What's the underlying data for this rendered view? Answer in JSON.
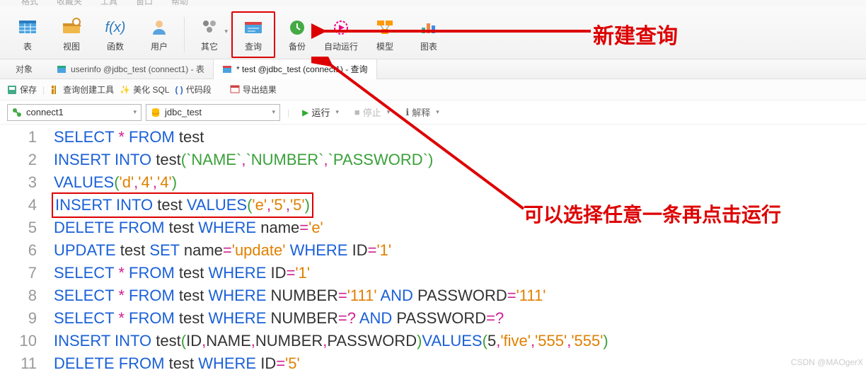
{
  "menubar": [
    "格式",
    "收藏夹",
    "工具",
    "窗口",
    "帮助"
  ],
  "ribbon": [
    {
      "id": "table",
      "label": "表",
      "icon": "table"
    },
    {
      "id": "view",
      "label": "视图",
      "icon": "view"
    },
    {
      "id": "func",
      "label": "函数",
      "icon": "fx"
    },
    {
      "id": "user",
      "label": "用户",
      "icon": "user"
    },
    {
      "sep": true
    },
    {
      "id": "other",
      "label": "其它",
      "icon": "other",
      "dd": true
    },
    {
      "id": "query",
      "label": "查询",
      "icon": "query",
      "active": true
    },
    {
      "id": "backup",
      "label": "备份",
      "icon": "backup"
    },
    {
      "id": "auto",
      "label": "自动运行",
      "icon": "auto"
    },
    {
      "id": "model",
      "label": "模型",
      "icon": "model"
    },
    {
      "id": "chart",
      "label": "图表",
      "icon": "chart"
    }
  ],
  "tabs": {
    "objects": "对象",
    "items": [
      {
        "icon": "tbl",
        "label": "userinfo @jdbc_test (connect1) - 表",
        "active": false
      },
      {
        "icon": "qry",
        "label": "* test @jdbc_test (connect1) - 查询",
        "active": true
      }
    ]
  },
  "qtoolbar": {
    "save": "保存",
    "qbuilder": "查询创建工具",
    "beautify": "美化 SQL",
    "snippet": "代码段",
    "export": "导出结果"
  },
  "combos": {
    "connection": "connect1",
    "database": "jdbc_test",
    "run": "运行",
    "stop": "停止",
    "explain": "解释"
  },
  "code": [
    {
      "n": 1,
      "tokens": [
        [
          "kw",
          "SELECT"
        ],
        [
          "sp",
          " "
        ],
        [
          "sy",
          "*"
        ],
        [
          "sp",
          " "
        ],
        [
          "kw",
          "FROM"
        ],
        [
          "sp",
          " "
        ],
        [
          "id",
          "test"
        ]
      ]
    },
    {
      "n": 2,
      "tokens": [
        [
          "kw",
          "INSERT"
        ],
        [
          "sp",
          " "
        ],
        [
          "kw",
          "INTO"
        ],
        [
          "sp",
          " "
        ],
        [
          "id",
          "test"
        ],
        [
          "bk",
          "("
        ],
        [
          "bk",
          "`NAME`"
        ],
        [
          "sy",
          ","
        ],
        [
          "bk",
          "`NUMBER`"
        ],
        [
          "sy",
          ","
        ],
        [
          "bk",
          "`PASSWORD`"
        ],
        [
          "bk",
          ")"
        ]
      ]
    },
    {
      "n": 3,
      "tokens": [
        [
          "kw",
          "VALUES"
        ],
        [
          "bk",
          "("
        ],
        [
          "str",
          "'d'"
        ],
        [
          "sy",
          ","
        ],
        [
          "str",
          "'4'"
        ],
        [
          "sy",
          ","
        ],
        [
          "str",
          "'4'"
        ],
        [
          "bk",
          ")"
        ]
      ]
    },
    {
      "n": 4,
      "hl": true,
      "tokens": [
        [
          "kw",
          "INSERT"
        ],
        [
          "sp",
          " "
        ],
        [
          "kw",
          "INTO"
        ],
        [
          "sp",
          " "
        ],
        [
          "id",
          "test"
        ],
        [
          "sp",
          " "
        ],
        [
          "kw",
          "VALUES"
        ],
        [
          "bk",
          "("
        ],
        [
          "str",
          "'e'"
        ],
        [
          "sy",
          ","
        ],
        [
          "str",
          "'5'"
        ],
        [
          "sy",
          ","
        ],
        [
          "str",
          "'5'"
        ],
        [
          "bk",
          ")"
        ]
      ]
    },
    {
      "n": 5,
      "tokens": [
        [
          "kw",
          "DELETE"
        ],
        [
          "sp",
          " "
        ],
        [
          "kw",
          "FROM"
        ],
        [
          "sp",
          " "
        ],
        [
          "id",
          "test"
        ],
        [
          "sp",
          " "
        ],
        [
          "kw",
          "WHERE"
        ],
        [
          "sp",
          " "
        ],
        [
          "id",
          "name"
        ],
        [
          "sy",
          "="
        ],
        [
          "str",
          "'e'"
        ]
      ]
    },
    {
      "n": 6,
      "tokens": [
        [
          "kw",
          "UPDATE"
        ],
        [
          "sp",
          " "
        ],
        [
          "id",
          "test"
        ],
        [
          "sp",
          " "
        ],
        [
          "kw",
          "SET"
        ],
        [
          "sp",
          " "
        ],
        [
          "id",
          "name"
        ],
        [
          "sy",
          "="
        ],
        [
          "str",
          "'update'"
        ],
        [
          "sp",
          " "
        ],
        [
          "kw",
          "WHERE"
        ],
        [
          "sp",
          " "
        ],
        [
          "id",
          "ID"
        ],
        [
          "sy",
          "="
        ],
        [
          "str",
          "'1'"
        ]
      ]
    },
    {
      "n": 7,
      "tokens": [
        [
          "kw",
          "SELECT"
        ],
        [
          "sp",
          " "
        ],
        [
          "sy",
          "*"
        ],
        [
          "sp",
          " "
        ],
        [
          "kw",
          "FROM"
        ],
        [
          "sp",
          " "
        ],
        [
          "id",
          "test"
        ],
        [
          "sp",
          " "
        ],
        [
          "kw",
          "WHERE"
        ],
        [
          "sp",
          " "
        ],
        [
          "id",
          "ID"
        ],
        [
          "sy",
          "="
        ],
        [
          "str",
          "'1'"
        ]
      ]
    },
    {
      "n": 8,
      "tokens": [
        [
          "kw",
          "SELECT"
        ],
        [
          "sp",
          " "
        ],
        [
          "sy",
          "*"
        ],
        [
          "sp",
          " "
        ],
        [
          "kw",
          "FROM"
        ],
        [
          "sp",
          " "
        ],
        [
          "id",
          "test"
        ],
        [
          "sp",
          " "
        ],
        [
          "kw",
          "WHERE"
        ],
        [
          "sp",
          " "
        ],
        [
          "id",
          "NUMBER"
        ],
        [
          "sy",
          "="
        ],
        [
          "str",
          "'111'"
        ],
        [
          "sp",
          " "
        ],
        [
          "kw",
          "AND"
        ],
        [
          "sp",
          " "
        ],
        [
          "id",
          "PASSWORD"
        ],
        [
          "sy",
          "="
        ],
        [
          "str",
          "'111'"
        ]
      ]
    },
    {
      "n": 9,
      "tokens": [
        [
          "kw",
          "SELECT"
        ],
        [
          "sp",
          " "
        ],
        [
          "sy",
          "*"
        ],
        [
          "sp",
          " "
        ],
        [
          "kw",
          "FROM"
        ],
        [
          "sp",
          " "
        ],
        [
          "id",
          "test"
        ],
        [
          "sp",
          " "
        ],
        [
          "kw",
          "WHERE"
        ],
        [
          "sp",
          " "
        ],
        [
          "id",
          "NUMBER"
        ],
        [
          "sy",
          "=?"
        ],
        [
          "sp",
          " "
        ],
        [
          "kw",
          "AND"
        ],
        [
          "sp",
          " "
        ],
        [
          "id",
          "PASSWORD"
        ],
        [
          "sy",
          "=?"
        ]
      ]
    },
    {
      "n": 10,
      "tokens": [
        [
          "kw",
          "INSERT"
        ],
        [
          "sp",
          " "
        ],
        [
          "kw",
          "INTO"
        ],
        [
          "sp",
          " "
        ],
        [
          "id",
          "test"
        ],
        [
          "bk",
          "("
        ],
        [
          "id",
          "ID"
        ],
        [
          "sy",
          ","
        ],
        [
          "id",
          "NAME"
        ],
        [
          "sy",
          ","
        ],
        [
          "id",
          "NUMBER"
        ],
        [
          "sy",
          ","
        ],
        [
          "id",
          "PASSWORD"
        ],
        [
          "bk",
          ")"
        ],
        [
          "kw",
          "VALUES"
        ],
        [
          "bk",
          "("
        ],
        [
          "id",
          "5"
        ],
        [
          "sy",
          ","
        ],
        [
          "str",
          "'five'"
        ],
        [
          "sy",
          ","
        ],
        [
          "str",
          "'555'"
        ],
        [
          "sy",
          ","
        ],
        [
          "str",
          "'555'"
        ],
        [
          "bk",
          ")"
        ]
      ]
    },
    {
      "n": 11,
      "tokens": [
        [
          "kw",
          "DELETE"
        ],
        [
          "sp",
          " "
        ],
        [
          "kw",
          "FROM"
        ],
        [
          "sp",
          " "
        ],
        [
          "id",
          "test"
        ],
        [
          "sp",
          " "
        ],
        [
          "kw",
          "WHERE"
        ],
        [
          "sp",
          " "
        ],
        [
          "id",
          "ID"
        ],
        [
          "sy",
          "="
        ],
        [
          "str",
          "'5'"
        ]
      ]
    }
  ],
  "annotations": {
    "top": "新建查询",
    "side": "可以选择任意一条再点击运行"
  },
  "watermark": "CSDN @MAOgerX"
}
